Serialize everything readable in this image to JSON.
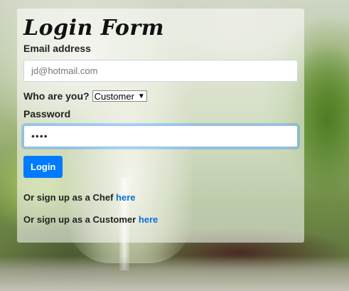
{
  "form": {
    "title": "Login Form",
    "email_label": "Email address",
    "email_placeholder": "jd@hotmail.com",
    "role_label": "Who are you?",
    "role_selected": "Customer",
    "password_label": "Password",
    "password_value": "••••",
    "login_button": "Login"
  },
  "signup": {
    "chef_prefix": "Or sign up as a Chef",
    "chef_link": "here",
    "customer_prefix": "Or sign up as a Customer",
    "customer_link": "here"
  },
  "colors": {
    "primary": "#007bff",
    "link": "#0b6fd6"
  },
  "icons": {
    "select_caret": "triangle-down"
  }
}
